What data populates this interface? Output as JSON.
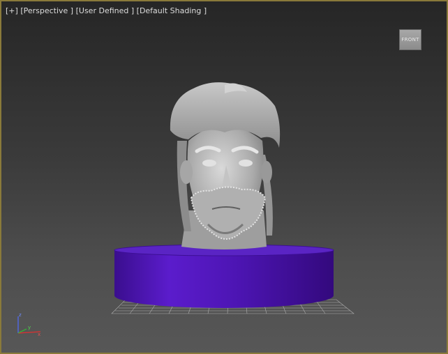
{
  "viewport": {
    "menu_plus": "[+]",
    "view_type": "[Perspective ]",
    "view_preset": "[User Defined ]",
    "shading_mode": "[Default Shading ]"
  },
  "viewcube": {
    "face_label": "FRONT"
  },
  "axis_gizmo": {
    "z_label": "z",
    "x_label": "x",
    "y_label": "y"
  },
  "colors": {
    "frame": "#8a7a3a",
    "base_cylinder": "#4f16b8",
    "head_mesh": "#b8b8b8",
    "grid": "#cfcfcf"
  }
}
